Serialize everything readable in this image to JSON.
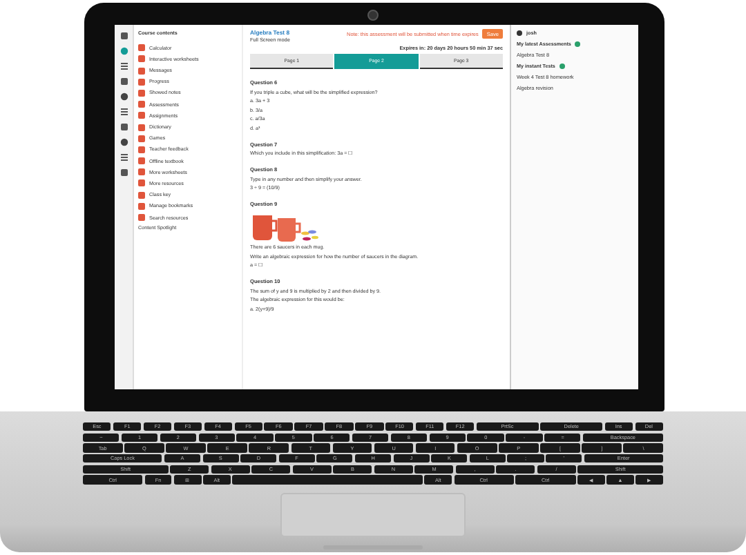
{
  "sidebar": {
    "title": "Course contents",
    "items": [
      {
        "label": "Calculator"
      },
      {
        "label": "Interactive worksheets"
      },
      {
        "label": "Messages"
      },
      {
        "label": "Progress"
      },
      {
        "label": "Showed notes"
      },
      {
        "label": "Assessments"
      },
      {
        "label": "Assignments"
      },
      {
        "label": "Dictionary"
      },
      {
        "label": "Games"
      },
      {
        "label": "Teacher feedback"
      },
      {
        "label": "Offline textbook"
      },
      {
        "label": "More worksheets"
      },
      {
        "label": "More resources"
      },
      {
        "label": "Class key"
      },
      {
        "label": "Manage bookmarks"
      },
      {
        "label": "Search resources"
      }
    ],
    "footer": "Content Spotlight"
  },
  "header": {
    "title": "Algebra Test 8",
    "subtitle": "Full Screen mode",
    "notice": "Note: this assessment will be submitted when time expires",
    "save": "Save",
    "timer": "Expires in: 20 days 20 hours 50 min 37 sec"
  },
  "tabs": [
    {
      "label": "Page 1",
      "selected": false
    },
    {
      "label": "Page 2",
      "selected": true
    },
    {
      "label": "Page 3",
      "selected": false
    }
  ],
  "questions": [
    {
      "title": "Question 6",
      "lines": [
        "If you triple a cube, what will be the simplified expression?",
        "a.  3a + 3",
        "b.  3/a",
        "c.  a/3a",
        "d.  a³"
      ],
      "picture": false
    },
    {
      "title": "Question 7",
      "lines": [
        "Which you include in this simplification:  3a  =  ☐"
      ],
      "picture": false
    },
    {
      "title": "Question 8",
      "lines": [
        "Type in any number and then simplify your answer.",
        "3 ÷ 9 = (10/9)"
      ],
      "picture": false
    },
    {
      "title": "Question 9",
      "lines": [
        "There are 6 saucers in each mug.",
        "Write an algebraic expression for how the number of saucers in the diagram.",
        "a =  ☐"
      ],
      "picture": true
    },
    {
      "title": "Question 10",
      "lines": [
        "The sum of y and 9 is multiplied by 2 and then divided by 9.",
        "The algebraic expression for this would be:",
        "a.  2(y+9)/9"
      ],
      "picture": false
    }
  ],
  "right": {
    "user": "josh",
    "sections": [
      {
        "title": "My latest Assessments",
        "items": [
          "Algebra Test 8"
        ]
      },
      {
        "title": "My instant Tests",
        "items": [
          "Week 4 Test 8 homework",
          "Algebra revision"
        ]
      }
    ]
  },
  "keyboard": {
    "rows": [
      {
        "keys": [
          "Esc",
          "F1",
          "F2",
          "F3",
          "F4",
          "F5",
          "F6",
          "F7",
          "F8",
          "F9",
          "F10",
          "F11",
          "F12",
          "PrtSc",
          "Delete",
          "Ins",
          "Del"
        ]
      },
      {
        "keys": [
          "~",
          "1",
          "2",
          "3",
          "4",
          "5",
          "6",
          "7",
          "8",
          "9",
          "0",
          "-",
          "=",
          "Backspace"
        ]
      },
      {
        "keys": [
          "Tab",
          "Q",
          "W",
          "E",
          "R",
          "T",
          "Y",
          "U",
          "I",
          "O",
          "P",
          "[",
          "]",
          "\\"
        ]
      },
      {
        "keys": [
          "Caps Lock",
          "A",
          "S",
          "D",
          "F",
          "G",
          "H",
          "J",
          "K",
          "L",
          ";",
          "'",
          "Enter"
        ]
      },
      {
        "keys": [
          "Shift",
          "Z",
          "X",
          "C",
          "V",
          "B",
          "N",
          "M",
          ",",
          ".",
          "/",
          "Shift"
        ]
      },
      {
        "keys": [
          "Ctrl",
          "Fn",
          "⊞",
          "Alt"
        ],
        "keys_after_space": [
          "Alt",
          "Ctrl",
          "Ctrl",
          "◀",
          "▲",
          "▶"
        ]
      }
    ]
  }
}
